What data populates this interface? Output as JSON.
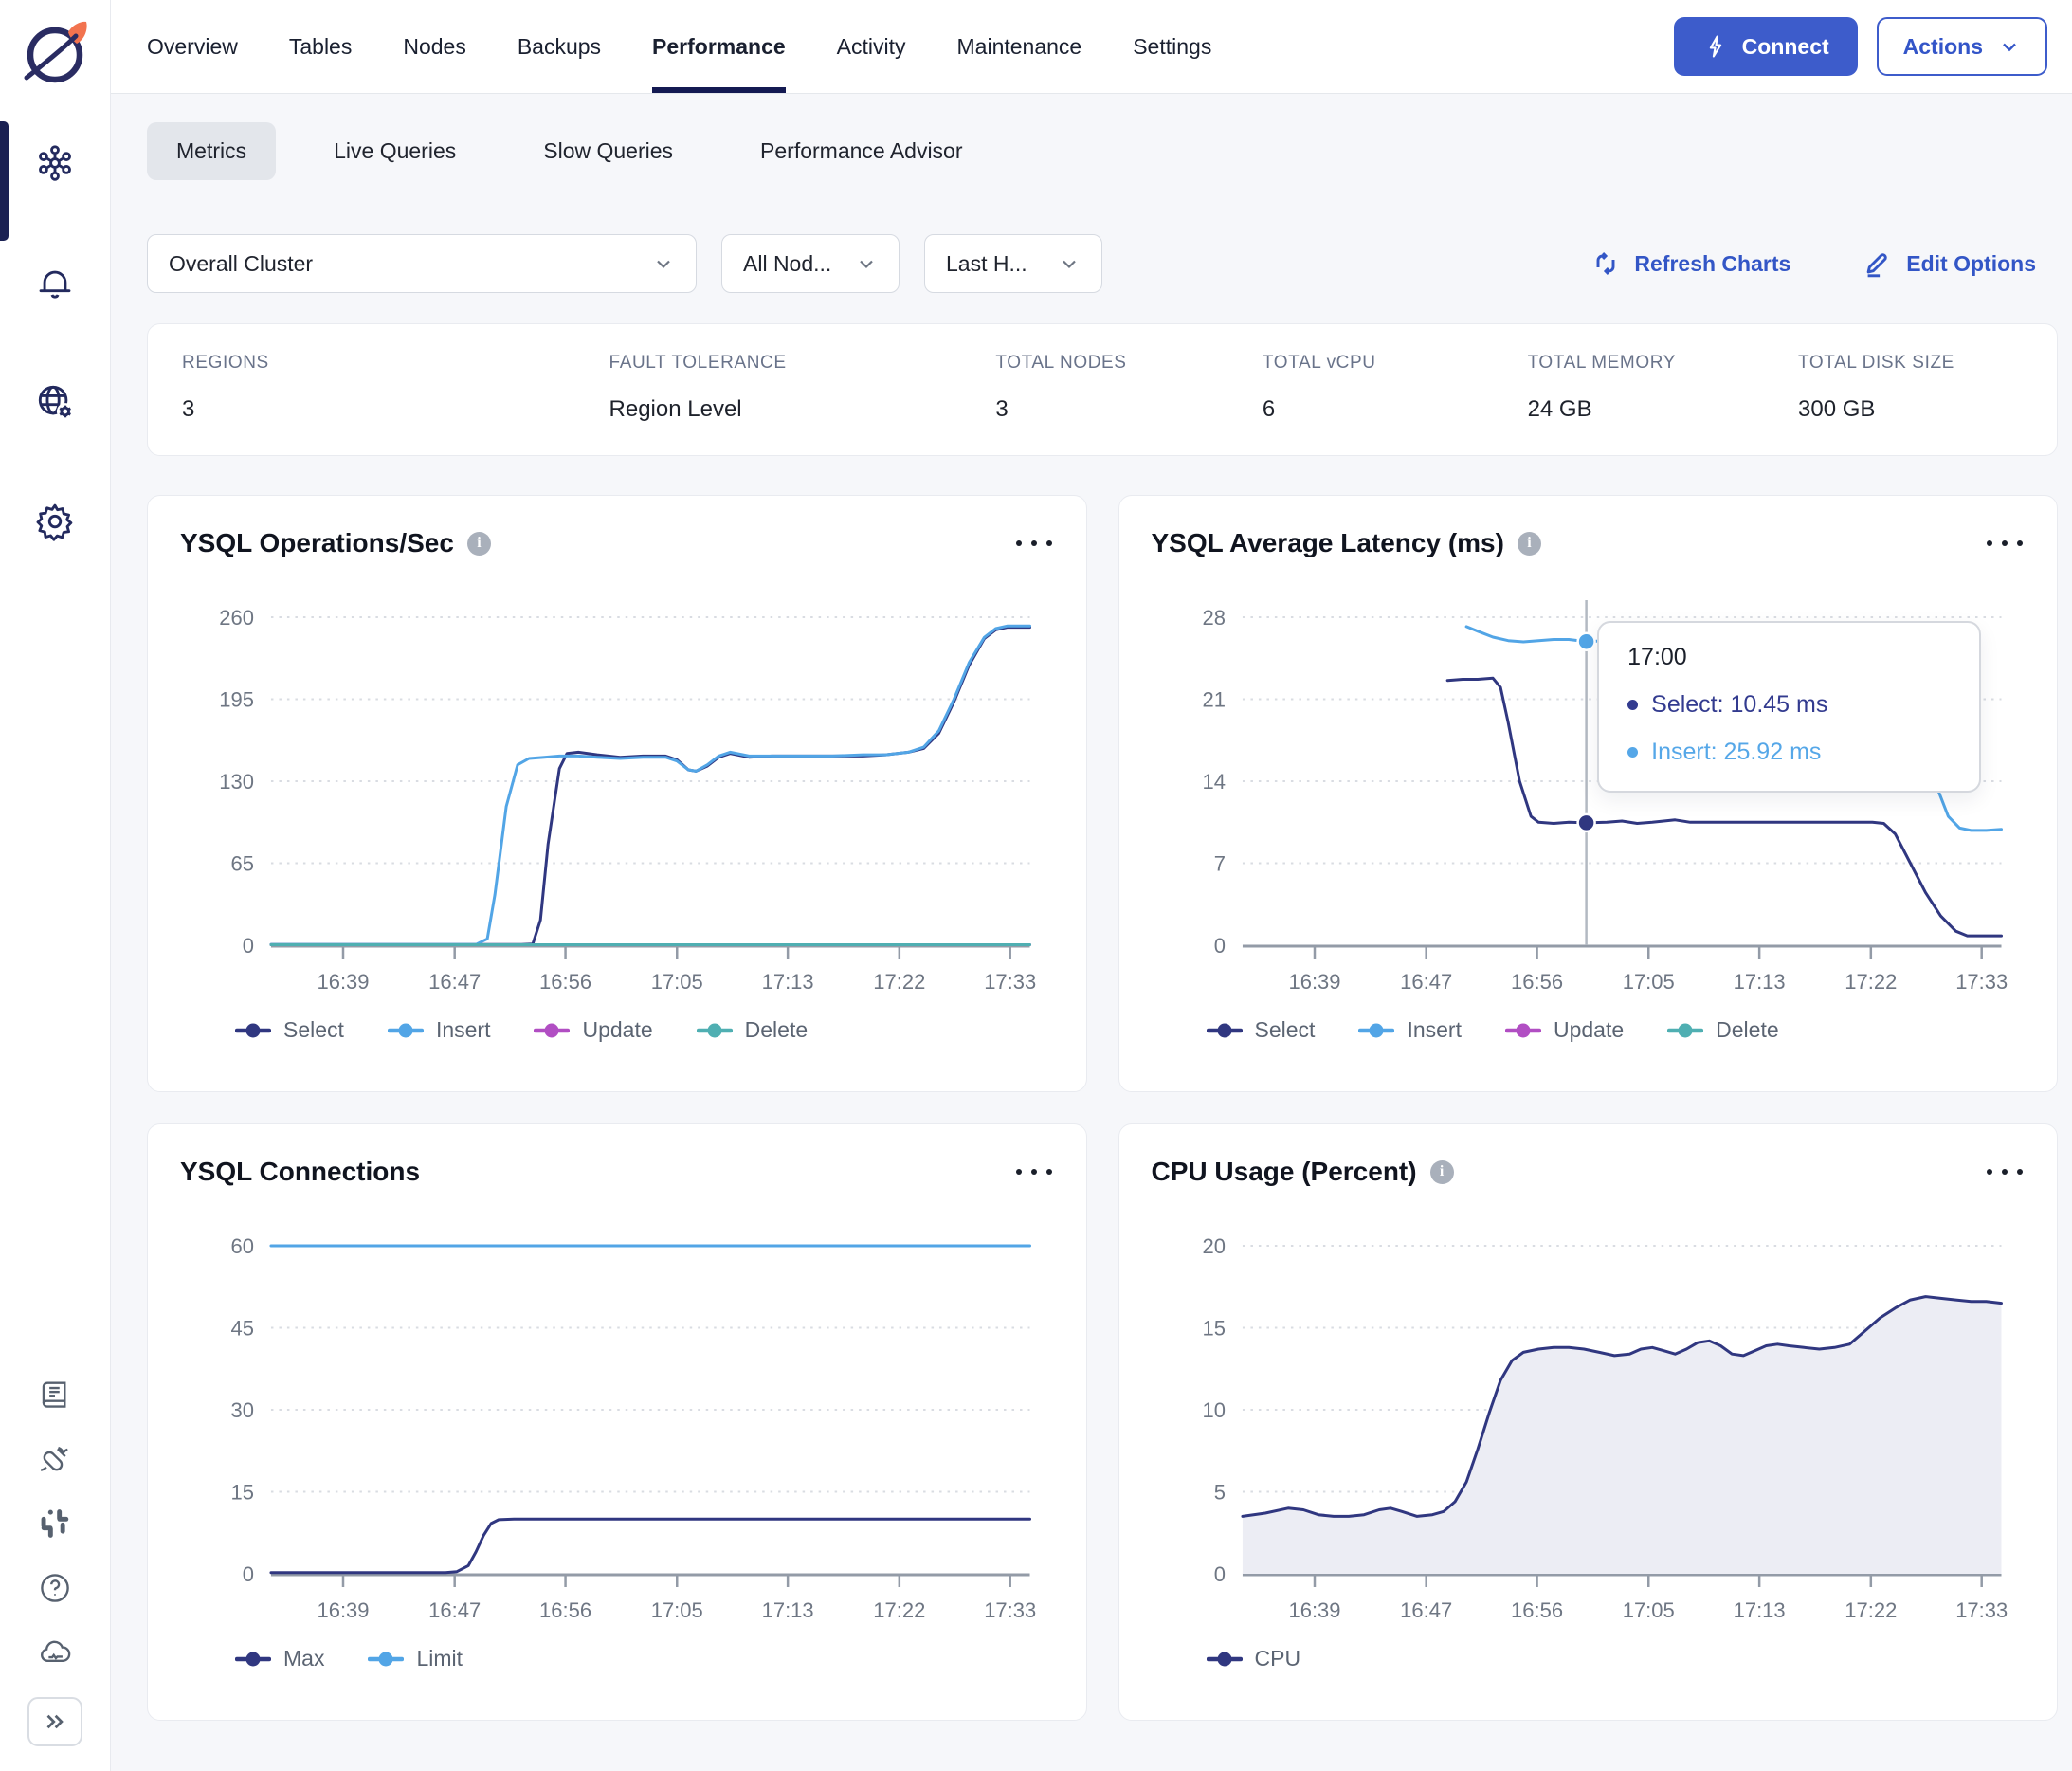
{
  "colors": {
    "accent_blue": "#3D5CCB",
    "link_blue": "#3356C6",
    "navy_series": "#303780",
    "blue_series": "#52A5E6",
    "purple_series": "#B14EC3",
    "teal_series": "#4FAFB2",
    "active_underline": "#141A52",
    "page_bg": "#F6F7FA"
  },
  "sidebar": {
    "icons_top": [
      {
        "name": "clusters",
        "active": true
      },
      {
        "name": "alerts-bell",
        "active": false
      },
      {
        "name": "network-globe",
        "active": false
      },
      {
        "name": "settings-gear",
        "active": false
      }
    ],
    "icons_bottom": [
      "docs-book",
      "integrations-plug",
      "slack",
      "help",
      "cloud-status"
    ],
    "expand": "collapse-expand"
  },
  "topnav": {
    "tabs": [
      {
        "label": "Overview",
        "active": false
      },
      {
        "label": "Tables",
        "active": false
      },
      {
        "label": "Nodes",
        "active": false
      },
      {
        "label": "Backups",
        "active": false
      },
      {
        "label": "Performance",
        "active": true
      },
      {
        "label": "Activity",
        "active": false
      },
      {
        "label": "Maintenance",
        "active": false
      },
      {
        "label": "Settings",
        "active": false
      }
    ],
    "connect_label": "Connect",
    "actions_label": "Actions"
  },
  "subtabs": [
    {
      "label": "Metrics",
      "active": true
    },
    {
      "label": "Live Queries",
      "active": false
    },
    {
      "label": "Slow Queries",
      "active": false
    },
    {
      "label": "Performance Advisor",
      "active": false
    }
  ],
  "filters": {
    "cluster": "Overall Cluster",
    "nodes": "All Nod...",
    "time": "Last H..."
  },
  "toolbar": {
    "refresh_label": "Refresh Charts",
    "edit_label": "Edit Options"
  },
  "stats": [
    {
      "label": "REGIONS",
      "value": "3"
    },
    {
      "label": "FAULT TOLERANCE",
      "value": "Region Level"
    },
    {
      "label": "TOTAL NODES",
      "value": "3"
    },
    {
      "label": "TOTAL vCPU",
      "value": "6"
    },
    {
      "label": "TOTAL MEMORY",
      "value": "24 GB"
    },
    {
      "label": "TOTAL DISK SIZE",
      "value": "300 GB"
    }
  ],
  "chart_data": [
    {
      "type": "line",
      "title": "YSQL Operations/Sec",
      "has_info": true,
      "ylim": [
        0,
        260
      ],
      "yticks": [
        0,
        65,
        130,
        195,
        260
      ],
      "xticks": [
        "16:39",
        "16:47",
        "16:56",
        "17:05",
        "17:13",
        "17:22",
        "17:33"
      ],
      "xtick_pos": [
        9.5,
        24.2,
        38.8,
        53.5,
        68.1,
        82.8,
        97.4
      ],
      "series": [
        {
          "name": "Select",
          "color": "#303780",
          "points": [
            [
              0,
              0.5
            ],
            [
              33,
              0.5
            ],
            [
              34.5,
              1
            ],
            [
              35.5,
              20
            ],
            [
              36.5,
              80
            ],
            [
              38,
              140
            ],
            [
              39,
              152
            ],
            [
              40.5,
              153
            ],
            [
              43,
              151
            ],
            [
              46,
              149
            ],
            [
              49,
              150
            ],
            [
              52,
              150
            ],
            [
              53.5,
              147
            ],
            [
              55,
              139
            ],
            [
              56,
              138
            ],
            [
              57.5,
              142
            ],
            [
              59,
              149
            ],
            [
              60.5,
              152
            ],
            [
              63,
              149
            ],
            [
              66,
              150
            ],
            [
              70,
              150
            ],
            [
              74,
              150
            ],
            [
              78,
              150
            ],
            [
              81,
              151
            ],
            [
              84,
              153
            ],
            [
              86,
              156
            ],
            [
              88,
              168
            ],
            [
              90,
              193
            ],
            [
              92,
              222
            ],
            [
              94,
              243
            ],
            [
              95.5,
              250
            ],
            [
              97,
              252
            ],
            [
              100,
              252
            ]
          ]
        },
        {
          "name": "Insert",
          "color": "#52A5E6",
          "points": [
            [
              0,
              0.5
            ],
            [
              27,
              0.5
            ],
            [
              28.5,
              5
            ],
            [
              29.5,
              40
            ],
            [
              31,
              110
            ],
            [
              32.5,
              143
            ],
            [
              34,
              148
            ],
            [
              36,
              149
            ],
            [
              38,
              150
            ],
            [
              40.5,
              150
            ],
            [
              43,
              149
            ],
            [
              46,
              148
            ],
            [
              49,
              149
            ],
            [
              52,
              149
            ],
            [
              53.5,
              146
            ],
            [
              55,
              139
            ],
            [
              56,
              138
            ],
            [
              57.5,
              143
            ],
            [
              59,
              150
            ],
            [
              60.5,
              153
            ],
            [
              63,
              150
            ],
            [
              66,
              150
            ],
            [
              70,
              150
            ],
            [
              74,
              150
            ],
            [
              78,
              151
            ],
            [
              81,
              151
            ],
            [
              84,
              153
            ],
            [
              86,
              157
            ],
            [
              88,
              170
            ],
            [
              90,
              195
            ],
            [
              92,
              224
            ],
            [
              94,
              244
            ],
            [
              95.5,
              251
            ],
            [
              97,
              253
            ],
            [
              100,
              253
            ]
          ]
        },
        {
          "name": "Update",
          "color": "#B14EC3",
          "points": [
            [
              0,
              0.4
            ],
            [
              100,
              0.4
            ]
          ]
        },
        {
          "name": "Delete",
          "color": "#4FAFB2",
          "points": [
            [
              0,
              0.4
            ],
            [
              100,
              0.4
            ]
          ]
        }
      ]
    },
    {
      "type": "line",
      "title": "YSQL Average Latency (ms)",
      "has_info": true,
      "ylim": [
        0,
        28
      ],
      "yticks": [
        0,
        7,
        14,
        21,
        28
      ],
      "xticks": [
        "16:39",
        "16:47",
        "16:56",
        "17:05",
        "17:13",
        "17:22",
        "17:33"
      ],
      "xtick_pos": [
        9.5,
        24.2,
        38.8,
        53.5,
        68.1,
        82.8,
        97.4
      ],
      "series": [
        {
          "name": "Select",
          "color": "#303780",
          "points": [
            [
              27,
              22.6
            ],
            [
              29,
              22.7
            ],
            [
              31,
              22.7
            ],
            [
              33,
              22.8
            ],
            [
              34,
              22
            ],
            [
              35,
              19
            ],
            [
              36.5,
              14
            ],
            [
              38,
              11
            ],
            [
              39,
              10.5
            ],
            [
              41,
              10.4
            ],
            [
              43,
              10.5
            ],
            [
              45.3,
              10.45
            ],
            [
              48,
              10.5
            ],
            [
              50,
              10.6
            ],
            [
              52,
              10.4
            ],
            [
              54,
              10.5
            ],
            [
              57,
              10.7
            ],
            [
              59,
              10.5
            ],
            [
              62,
              10.5
            ],
            [
              65,
              10.5
            ],
            [
              68,
              10.5
            ],
            [
              71,
              10.5
            ],
            [
              74,
              10.5
            ],
            [
              77,
              10.5
            ],
            [
              80,
              10.5
            ],
            [
              83,
              10.5
            ],
            [
              84.5,
              10.4
            ],
            [
              86,
              9.5
            ],
            [
              88,
              7
            ],
            [
              90,
              4.5
            ],
            [
              92,
              2.5
            ],
            [
              94,
              1.2
            ],
            [
              95.5,
              0.8
            ],
            [
              97,
              0.8
            ],
            [
              100,
              0.8
            ]
          ]
        },
        {
          "name": "Insert",
          "color": "#52A5E6",
          "points": [
            [
              29.5,
              27.2
            ],
            [
              31,
              26.8
            ],
            [
              33,
              26.3
            ],
            [
              35,
              26.0
            ],
            [
              37,
              25.9
            ],
            [
              39,
              26.0
            ],
            [
              41,
              26.1
            ],
            [
              43,
              26.1
            ],
            [
              45.3,
              25.92
            ],
            [
              48,
              26.0
            ],
            [
              50,
              26.0
            ],
            [
              53,
              26.1
            ],
            [
              56,
              26.2
            ],
            [
              58,
              26.2
            ],
            [
              60,
              26.2
            ],
            [
              62,
              26.1
            ],
            [
              64,
              26.0
            ],
            [
              66,
              25.9
            ],
            [
              68,
              25.9
            ],
            [
              71,
              25.8
            ],
            [
              74,
              25.8
            ],
            [
              77,
              25.8
            ],
            [
              80,
              25.7
            ],
            [
              83,
              25.7
            ],
            [
              85.5,
              25.6
            ],
            [
              87,
              24
            ],
            [
              88.5,
              21
            ],
            [
              90,
              17
            ],
            [
              91.5,
              13.5
            ],
            [
              93,
              11
            ],
            [
              94.5,
              10
            ],
            [
              96,
              9.8
            ],
            [
              98,
              9.8
            ],
            [
              100,
              9.9
            ]
          ]
        },
        {
          "name": "Update",
          "color": "#B14EC3",
          "points": []
        },
        {
          "name": "Delete",
          "color": "#4FAFB2",
          "points": []
        }
      ],
      "crosshair": {
        "x": 45.3,
        "markers": [
          {
            "name": "Select",
            "value": 10.45,
            "color": "#303780"
          },
          {
            "name": "Insert",
            "value": 25.92,
            "color": "#52A5E6"
          }
        ]
      },
      "tooltip": {
        "time": "17:00",
        "lines": [
          {
            "text": "Select: 10.45 ms",
            "color": "#333B8F"
          },
          {
            "text": "Insert: 25.92 ms",
            "color": "#55A7E8"
          }
        ]
      }
    },
    {
      "type": "line",
      "title": "YSQL Connections",
      "has_info": false,
      "ylim": [
        0,
        60
      ],
      "yticks": [
        0,
        15,
        30,
        45,
        60
      ],
      "xticks": [
        "16:39",
        "16:47",
        "16:56",
        "17:05",
        "17:13",
        "17:22",
        "17:33"
      ],
      "xtick_pos": [
        9.5,
        24.2,
        38.8,
        53.5,
        68.1,
        82.8,
        97.4
      ],
      "series": [
        {
          "name": "Max",
          "color": "#303780",
          "points": [
            [
              0,
              0.2
            ],
            [
              23,
              0.2
            ],
            [
              24.5,
              0.4
            ],
            [
              26,
              1.5
            ],
            [
              27,
              4
            ],
            [
              28,
              7
            ],
            [
              29,
              9.2
            ],
            [
              30,
              9.9
            ],
            [
              32,
              10
            ],
            [
              100,
              10
            ]
          ]
        },
        {
          "name": "Limit",
          "color": "#52A5E6",
          "points": [
            [
              0,
              60
            ],
            [
              100,
              60
            ]
          ]
        }
      ]
    },
    {
      "type": "area",
      "title": "CPU Usage (Percent)",
      "has_info": true,
      "ylim": [
        0,
        20
      ],
      "yticks": [
        0,
        5,
        10,
        15,
        20
      ],
      "xticks": [
        "16:39",
        "16:47",
        "16:56",
        "17:05",
        "17:13",
        "17:22",
        "17:33"
      ],
      "xtick_pos": [
        9.5,
        24.2,
        38.8,
        53.5,
        68.1,
        82.8,
        97.4
      ],
      "series": [
        {
          "name": "CPU",
          "color": "#303780",
          "fill": "#ECEDF4",
          "points": [
            [
              0,
              3.5
            ],
            [
              3,
              3.7
            ],
            [
              6,
              4.0
            ],
            [
              8,
              3.9
            ],
            [
              10,
              3.6
            ],
            [
              12,
              3.5
            ],
            [
              14,
              3.5
            ],
            [
              16,
              3.6
            ],
            [
              18,
              3.9
            ],
            [
              19.5,
              4.0
            ],
            [
              21,
              3.8
            ],
            [
              23,
              3.5
            ],
            [
              25,
              3.6
            ],
            [
              26.5,
              3.8
            ],
            [
              28,
              4.4
            ],
            [
              29.5,
              5.6
            ],
            [
              31,
              7.6
            ],
            [
              32.5,
              9.8
            ],
            [
              34,
              11.8
            ],
            [
              35.5,
              13.0
            ],
            [
              37,
              13.5
            ],
            [
              39,
              13.7
            ],
            [
              41,
              13.8
            ],
            [
              43,
              13.8
            ],
            [
              45,
              13.7
            ],
            [
              47,
              13.5
            ],
            [
              49,
              13.3
            ],
            [
              51,
              13.4
            ],
            [
              52.5,
              13.7
            ],
            [
              54,
              13.8
            ],
            [
              55.5,
              13.6
            ],
            [
              57,
              13.4
            ],
            [
              58.5,
              13.7
            ],
            [
              60,
              14.1
            ],
            [
              61.5,
              14.2
            ],
            [
              63,
              13.9
            ],
            [
              64.5,
              13.4
            ],
            [
              66,
              13.3
            ],
            [
              67.5,
              13.6
            ],
            [
              69,
              13.9
            ],
            [
              70.5,
              14.0
            ],
            [
              72,
              13.9
            ],
            [
              74,
              13.8
            ],
            [
              76,
              13.7
            ],
            [
              78,
              13.8
            ],
            [
              80,
              14.0
            ],
            [
              82,
              14.8
            ],
            [
              84,
              15.6
            ],
            [
              86,
              16.2
            ],
            [
              88,
              16.7
            ],
            [
              90,
              16.9
            ],
            [
              92,
              16.8
            ],
            [
              94,
              16.7
            ],
            [
              96,
              16.6
            ],
            [
              98,
              16.6
            ],
            [
              100,
              16.5
            ]
          ]
        }
      ]
    }
  ]
}
